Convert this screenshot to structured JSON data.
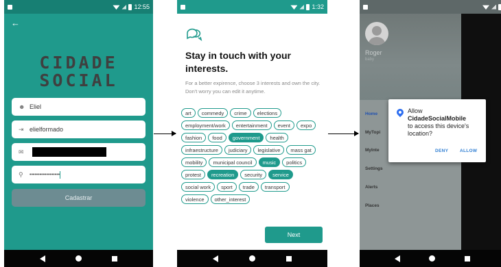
{
  "phone1": {
    "status_time": "12:55",
    "back_icon": "arrow-left-icon",
    "logo_line1": "CIDADE",
    "logo_line2": "SOCIAL",
    "name_value": "Eliel",
    "username_value": "elielformado",
    "password_value": "••••••••••••••••••",
    "submit_label": "Cadastrar",
    "colors": {
      "background": "#1f9a8c",
      "button": "#6d8c92"
    }
  },
  "phone2": {
    "status_time": "1:32",
    "title": "Stay in touch with your interests.",
    "description": "For a better expirence, choose 3 interests and own the city. Don't worry you can edit it anytime.",
    "chip_rows": [
      [
        {
          "label": "art",
          "selected": false
        },
        {
          "label": "commedy",
          "selected": false
        },
        {
          "label": "crime",
          "selected": false
        },
        {
          "label": "elections",
          "selected": false
        }
      ],
      [
        {
          "label": "employment/work",
          "selected": false
        },
        {
          "label": "entertainment",
          "selected": false
        },
        {
          "label": "event",
          "selected": false
        },
        {
          "label": "expo",
          "selected": false
        }
      ],
      [
        {
          "label": "fashion",
          "selected": false
        },
        {
          "label": "food",
          "selected": false
        },
        {
          "label": "government",
          "selected": true
        },
        {
          "label": "health",
          "selected": false
        }
      ],
      [
        {
          "label": "infraestructure",
          "selected": false
        },
        {
          "label": "judiciary",
          "selected": false
        },
        {
          "label": "legislative",
          "selected": false
        },
        {
          "label": "mass gat",
          "selected": false
        }
      ],
      [
        {
          "label": "mobility",
          "selected": false
        },
        {
          "label": "municipal council",
          "selected": false
        },
        {
          "label": "music",
          "selected": true
        },
        {
          "label": "politics",
          "selected": false
        }
      ],
      [
        {
          "label": "protest",
          "selected": false
        },
        {
          "label": "recreation",
          "selected": true
        },
        {
          "label": "security",
          "selected": false
        },
        {
          "label": "service",
          "selected": true
        }
      ],
      [
        {
          "label": "social work",
          "selected": false
        },
        {
          "label": "sport",
          "selected": false
        },
        {
          "label": "trade",
          "selected": false
        },
        {
          "label": "transport",
          "selected": false
        }
      ],
      [
        {
          "label": "violence",
          "selected": false
        },
        {
          "label": "other_interest",
          "selected": false
        }
      ]
    ],
    "next_label": "Next",
    "colors": {
      "accent": "#1f9a8c"
    }
  },
  "phone3": {
    "user_name": "Roger",
    "user_sub": "baby",
    "menu": [
      "Home",
      "MyTopi",
      "MyInte",
      "Settings",
      "Alerts",
      "Places"
    ],
    "dialog_line1": "Allow",
    "dialog_app": "CidadeSocialMobile",
    "dialog_line3": "to access this device's location?",
    "deny_label": "DENY",
    "allow_label": "ALLOW",
    "colors": {
      "dialog_button": "#2d7dd2",
      "pin": "#2d6ef0"
    }
  }
}
